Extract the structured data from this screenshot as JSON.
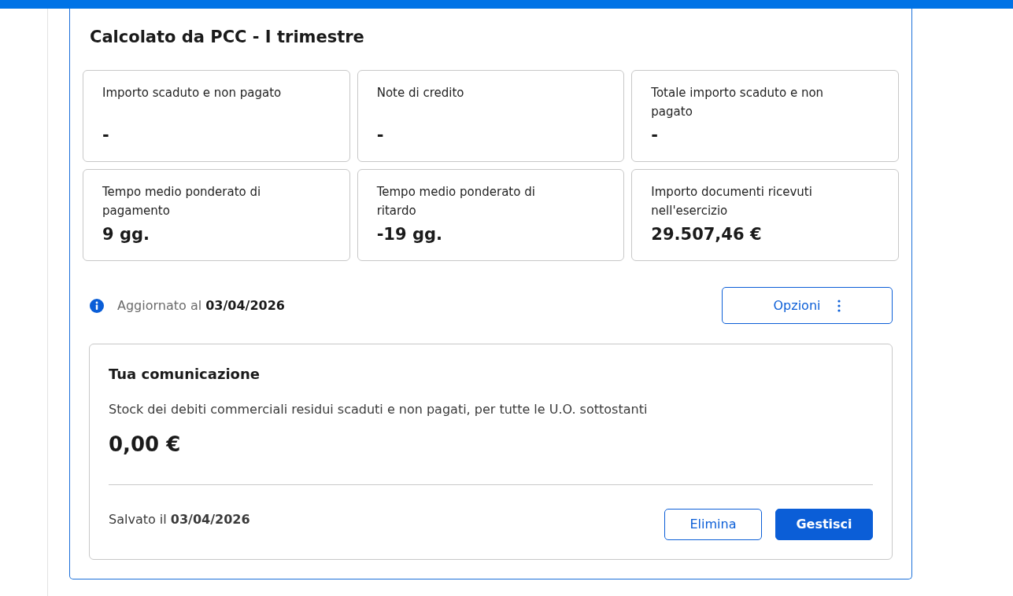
{
  "title": "Calcolato da PCC - I trimestre",
  "stats": [
    {
      "label": "Importo scaduto e non pagato",
      "value": "-"
    },
    {
      "label": "Note di credito",
      "value": "-"
    },
    {
      "label": "Totale importo scaduto e non pagato",
      "value": "-"
    },
    {
      "label": "Tempo medio ponderato di pagamento",
      "value": "9 gg."
    },
    {
      "label": "Tempo medio ponderato di ritardo",
      "value": "-19 gg."
    },
    {
      "label": "Importo documenti ricevuti nell'esercizio",
      "value": "29.507,46 €"
    }
  ],
  "update_info": "Aggiornato al **03/04/2026**",
  "options_button": {
    "label": "Opzioni"
  },
  "communication": {
    "title": "Tua comunicazione",
    "description": "Stock dei debiti commerciali residui scaduti e non pagati, per tutte le U.O. sottostanti",
    "amount": "0,00 €",
    "saved_info": "Salvato il **03/04/2026**",
    "buttons": [
      {
        "label": "Elimina",
        "kind": "outline"
      },
      {
        "label": "Gestisci",
        "kind": "primary"
      }
    ]
  }
}
